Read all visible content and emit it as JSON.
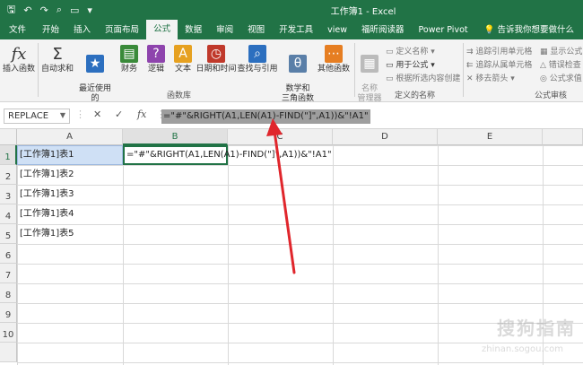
{
  "window": {
    "title": "工作簿1  -  Excel"
  },
  "tabs": [
    "文件",
    "开始",
    "插入",
    "页面布局",
    "公式",
    "数据",
    "审阅",
    "视图",
    "开发工具",
    "view",
    "福昕阅读器",
    "Power Pivot"
  ],
  "active_tab": "公式",
  "tell_me": "告诉我你想要做什么",
  "ribbon": {
    "insert_function": "插入函数",
    "autosum": "自动求和",
    "recent": "最近使用的\n函数",
    "finance": "财务",
    "logic": "逻辑",
    "text": "文本",
    "datetime": "日期和时间",
    "lookup": "查找与引用",
    "math": "数学和\n三角函数",
    "other": "其他函数",
    "group_library": "函数库",
    "name_manager": "名称\n管理器",
    "define_name": "定义名称",
    "use_in_formula": "用于公式",
    "create_from_sel": "根据所选内容创建",
    "group_names": "定义的名称",
    "trace_precedents": "追踪引用单元格",
    "trace_dependents": "追踪从属单元格",
    "remove_arrows": "移去箭头",
    "show_formulas": "显示公式",
    "error_check": "错误检查",
    "eval_formula": "公式求值",
    "group_audit": "公式审核"
  },
  "namebox": "REPLACE",
  "formula": "=\"#\"&RIGHT(A1,LEN(A1)-FIND(\"]\",A1))&\"!A1\"",
  "columns": [
    "A",
    "B",
    "C",
    "D",
    "E"
  ],
  "rows": [
    "1",
    "2",
    "3",
    "4",
    "5",
    "6",
    "7",
    "8",
    "9",
    "10"
  ],
  "cells": {
    "A1": "[工作簿1]表1",
    "A2": "[工作簿1]表2",
    "A3": "[工作簿1]表3",
    "A4": "[工作簿1]表4",
    "A5": "[工作簿1]表5",
    "B1": "=\"#\"&RIGHT(A1,LEN(A1)-FIND(\"]\",A1))&\"!A1\""
  },
  "watermark": {
    "brand": "搜狗指南",
    "site": "zhinan.sogou.com"
  },
  "colors": {
    "excel_green": "#217346",
    "arrow_red": "#e0262c"
  }
}
